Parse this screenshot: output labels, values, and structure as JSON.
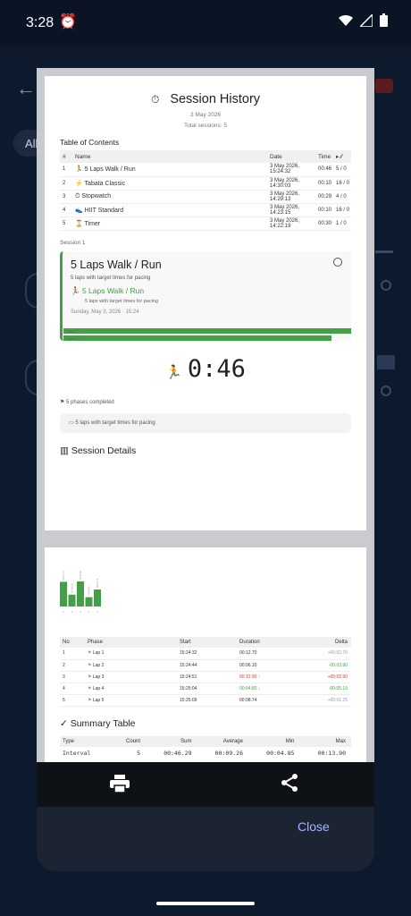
{
  "status": {
    "time": "3:28"
  },
  "background": {
    "chip": "All"
  },
  "report": {
    "title": "Session History",
    "date": "3 May 2026",
    "total": "Total sessions: 5",
    "toc_heading": "Table of Contents",
    "toc_cols": [
      "#",
      "Name",
      "Date",
      "Time",
      "▸ ⁄⁄"
    ],
    "toc_rows": [
      {
        "n": "1",
        "icon": "🏃",
        "name": "5 Laps Walk / Run",
        "date": "3 May 2026, 15:24:32",
        "time": "00:46",
        "ratio": "5 / 0"
      },
      {
        "n": "2",
        "icon": "⚡",
        "name": "Tabata Classic",
        "date": "3 May 2026, 14:30:03",
        "time": "00:10",
        "ratio": "16 / 0"
      },
      {
        "n": "3",
        "icon": "⏱",
        "name": "Stopwatch",
        "date": "3 May 2026, 14:29:13",
        "time": "00:29",
        "ratio": "4 / 0"
      },
      {
        "n": "4",
        "icon": "👟",
        "name": "HIIT Standard",
        "date": "3 May 2026, 14:23:15",
        "time": "00:10",
        "ratio": "16 / 0"
      },
      {
        "n": "5",
        "icon": "⌛",
        "name": "Timer",
        "date": "3 May 2026, 14:22:19",
        "time": "00:30",
        "ratio": "1 / 0"
      }
    ],
    "session_label": "Session 1",
    "card": {
      "title": "5 Laps Walk / Run",
      "subtitle": "5 laps with target times for pacing",
      "green_title": "5 Laps Walk / Run",
      "green_sub": "5 laps with target times for pacing",
      "datetime": "Sunday, May 3, 2026 · 15:24",
      "plan_label": "Plan",
      "fact_label": "Fact"
    },
    "timer": "0:46",
    "phases_done": "5 phases completed",
    "note": "5 laps with target times for pacing",
    "details_heading": "Session Details",
    "chart_labels": [
      "00:12.70",
      "00:06.10",
      "00:12.90",
      "00:04.80",
      "00:08.74"
    ],
    "chart_xticks": [
      "1",
      "2",
      "3",
      "4",
      "5"
    ],
    "phase_cols": [
      "No",
      "Phase",
      "Start",
      "Duration",
      "Delta"
    ],
    "phase_rows": [
      {
        "no": "1",
        "phase": "Lap 1",
        "start": "15:24:32",
        "duration": "00:12.70",
        "delta": "+00:02.70",
        "dcolor": "#999",
        "hl": ""
      },
      {
        "no": "2",
        "phase": "Lap 2",
        "start": "15:24:44",
        "duration": "00:06.10",
        "delta": "-00:03.90",
        "dcolor": "#43a047",
        "hl": ""
      },
      {
        "no": "3",
        "phase": "Lap 3",
        "start": "15:24:51",
        "duration": "00:12.90 ↑",
        "delta": "+00:02.90",
        "dcolor": "#e53935",
        "hl": "#e53935"
      },
      {
        "no": "4",
        "phase": "Lap 4",
        "start": "15:25:04",
        "duration": "00:04.80 ↓",
        "delta": "-00:05.19",
        "dcolor": "#43a047",
        "hl": "#43a047"
      },
      {
        "no": "5",
        "phase": "Lap 5",
        "start": "15:25:09",
        "duration": "00:08.74",
        "delta": "+00:01.25",
        "dcolor": "#999",
        "hl": ""
      }
    ],
    "summary_heading": "✓ Summary Table",
    "summary_cols": [
      "Type",
      "Count",
      "Sum",
      "Average",
      "Min",
      "Max"
    ],
    "summary_row": [
      "Interval",
      "5",
      "00:46.29",
      "00:09.26",
      "00:04.85",
      "00:13.90"
    ]
  },
  "actions": {
    "close": "Close"
  },
  "colors": {
    "accent": "#43a047",
    "negative": "#e53935",
    "close": "#a8b4ff"
  }
}
